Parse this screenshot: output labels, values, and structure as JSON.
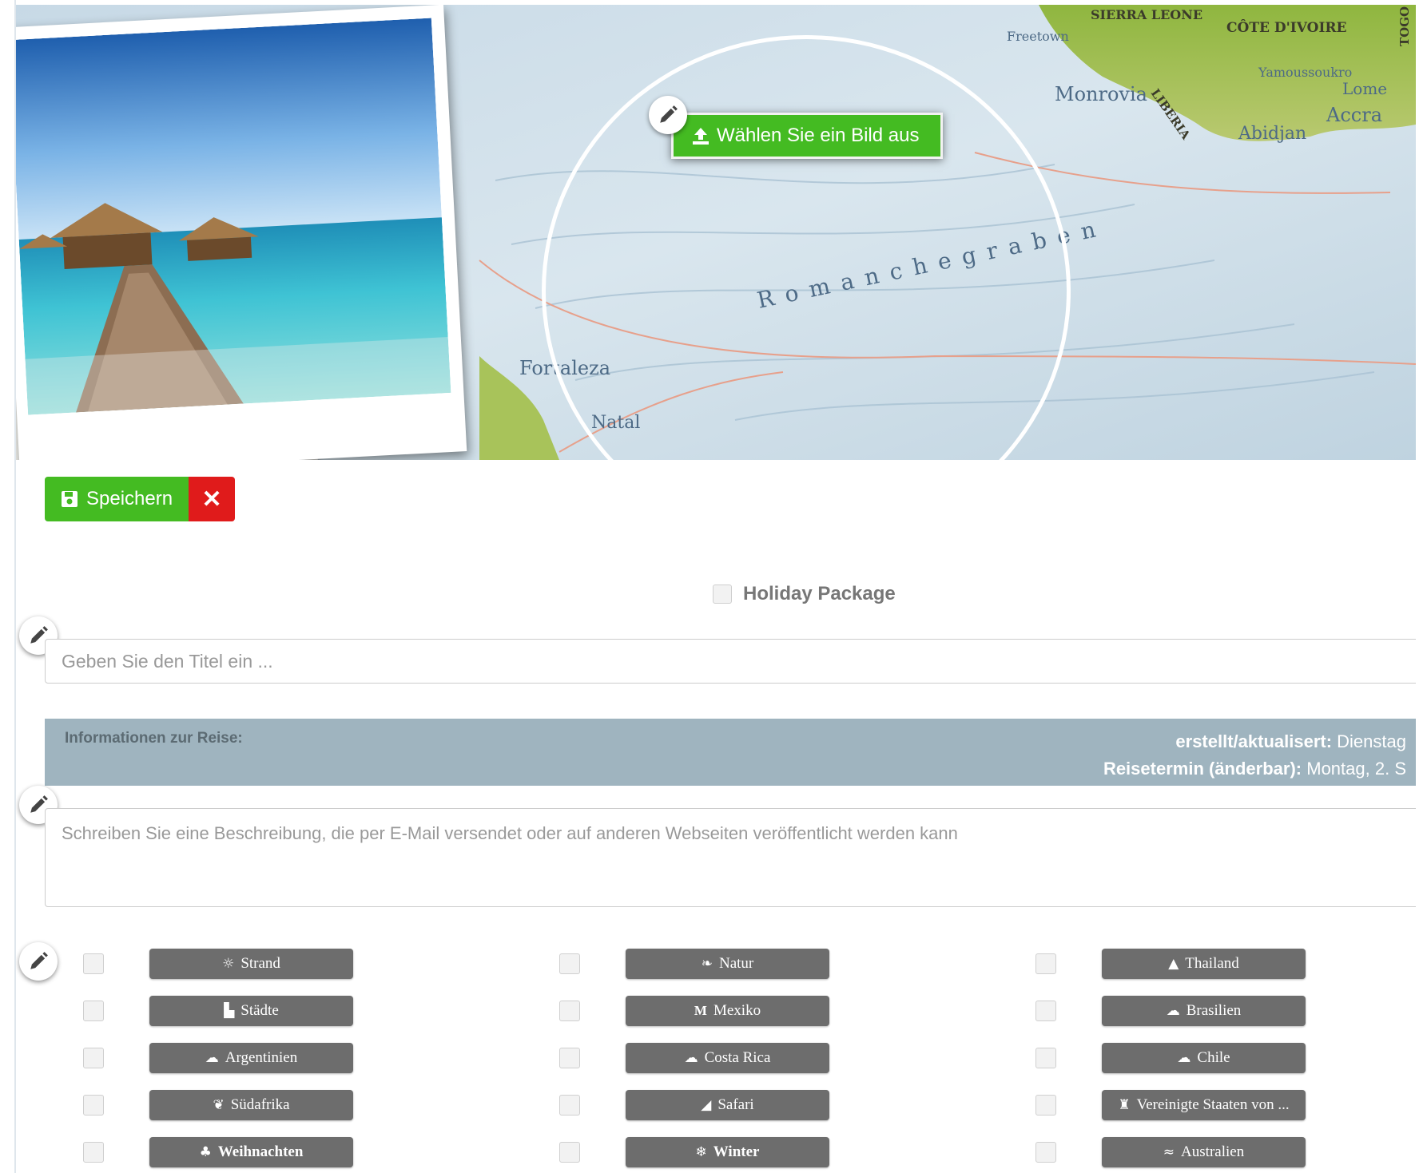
{
  "hero": {
    "choose_image_label": "Wählen Sie ein Bild aus",
    "map_labels": {
      "sierra_leone": "SIERRA LEONE",
      "freetown": "Freetown",
      "cote_divoire": "CÔTE D'IVOIRE",
      "togo": "TOGO",
      "monrovia": "Monrovia",
      "liberia": "LIBERIA",
      "yamoussoukro": "Yamoussoukro",
      "abidjan": "Abidjan",
      "accra": "Accra",
      "lome": "Lome",
      "fortaleza": "Fortaleza",
      "natal": "Natal",
      "romanche": "Romanchegraben"
    }
  },
  "toolbar": {
    "save_label": "Speichern",
    "cancel_label": "✕"
  },
  "holiday_package": {
    "label": "Holiday Package",
    "checked": false
  },
  "title_field": {
    "placeholder": "Geben Sie den Titel ein ...",
    "value": ""
  },
  "info": {
    "label": "Informationen zur Reise:",
    "created_label": "erstellt/aktualisert:",
    "created_value": "Dienstag",
    "travel_date_label": "Reisetermin (änderbar):",
    "travel_date_value": "Montag, 2. S"
  },
  "description_field": {
    "placeholder": "Schreiben Sie eine Beschreibung, die per E-Mail versendet oder auf anderen Webseiten veröffentlicht werden kann",
    "value": ""
  },
  "tags": [
    {
      "label": "Strand",
      "icon": "sun-icon",
      "glyph": "☼"
    },
    {
      "label": "Natur",
      "icon": "leaf-icon",
      "glyph": "❧"
    },
    {
      "label": "Thailand",
      "icon": "temple-icon",
      "glyph": "▲"
    },
    {
      "label": "Städte",
      "icon": "city-icon",
      "glyph": "▙"
    },
    {
      "label": "Mexiko",
      "icon": "m-icon",
      "glyph": "M"
    },
    {
      "label": "Brasilien",
      "icon": "cloud-icon",
      "glyph": "☁"
    },
    {
      "label": "Argentinien",
      "icon": "cloud-icon",
      "glyph": "☁"
    },
    {
      "label": "Costa Rica",
      "icon": "cloud-icon",
      "glyph": "☁"
    },
    {
      "label": "Chile",
      "icon": "cloud-icon",
      "glyph": "☁"
    },
    {
      "label": "Südafrika",
      "icon": "pepper-icon",
      "glyph": "❦"
    },
    {
      "label": "Safari",
      "icon": "tent-icon",
      "glyph": "◢"
    },
    {
      "label": "Vereinigte Staaten von ...",
      "icon": "statue-icon",
      "glyph": "♜"
    },
    {
      "label": "Weihnachten",
      "icon": "tree-icon",
      "glyph": "♣"
    },
    {
      "label": "Winter",
      "icon": "snowflake-icon",
      "glyph": "❄"
    },
    {
      "label": "Australien",
      "icon": "kangaroo-icon",
      "glyph": "≈"
    }
  ],
  "colors": {
    "primary_green": "#44bb22",
    "cancel_red": "#e01b1b",
    "info_bar": "#9fb4bf",
    "tag_button": "#6d6d6d"
  }
}
